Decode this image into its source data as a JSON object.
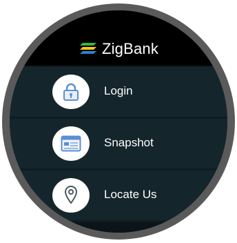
{
  "app": {
    "name": "ZigBank",
    "logo_icon": "zigbank-stripes-logo",
    "colors": {
      "screen_bg": "#0f1c21",
      "header_bg": "#000000",
      "item_bg": "#15252c",
      "text": "#ffffff",
      "icon_blue": "#5b8fd1",
      "logo_green": "#38b24a",
      "logo_yellow": "#f6c315",
      "logo_blue": "#2d7fd3"
    }
  },
  "menu": {
    "items": [
      {
        "label": "Login",
        "icon": "lock-icon"
      },
      {
        "label": "Snapshot",
        "icon": "browser-window-icon"
      },
      {
        "label": "Locate Us",
        "icon": "location-pin-icon"
      }
    ]
  }
}
